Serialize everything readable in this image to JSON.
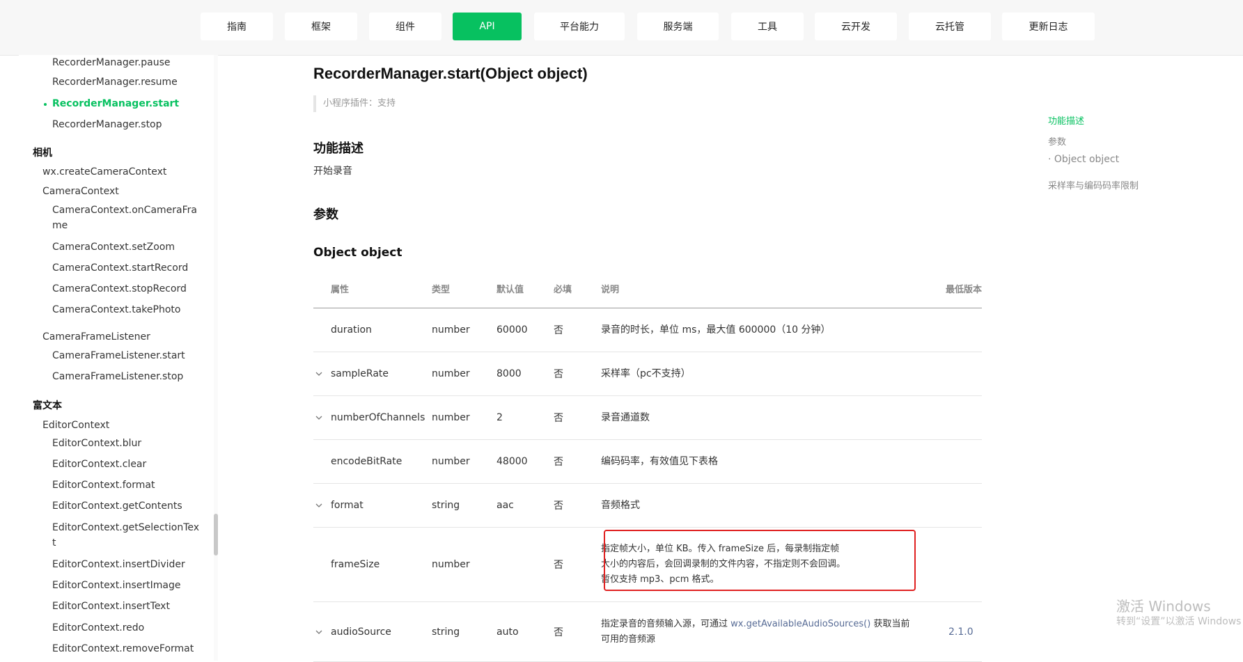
{
  "nav": {
    "items": [
      {
        "label": "指南"
      },
      {
        "label": "框架"
      },
      {
        "label": "组件"
      },
      {
        "label": "API"
      },
      {
        "label": "平台能力"
      },
      {
        "label": "服务端"
      },
      {
        "label": "工具"
      },
      {
        "label": "云开发"
      },
      {
        "label": "云托管"
      },
      {
        "label": "更新日志"
      }
    ],
    "active": "API"
  },
  "sidebar": {
    "items": [
      {
        "label": "RecorderManager.pause"
      },
      {
        "label": "RecorderManager.resume"
      },
      {
        "label": "RecorderManager.start"
      },
      {
        "label": "RecorderManager.stop"
      },
      {
        "label": "相机"
      },
      {
        "label": "wx.createCameraContext"
      },
      {
        "label": "CameraContext"
      },
      {
        "label": "CameraContext.onCameraFra"
      },
      {
        "label": "me"
      },
      {
        "label": "CameraContext.setZoom"
      },
      {
        "label": "CameraContext.startRecord"
      },
      {
        "label": "CameraContext.stopRecord"
      },
      {
        "label": "CameraContext.takePhoto"
      },
      {
        "label": "CameraFrameListener"
      },
      {
        "label": "CameraFrameListener.start"
      },
      {
        "label": "CameraFrameListener.stop"
      },
      {
        "label": "富文本"
      },
      {
        "label": "EditorContext"
      },
      {
        "label": "EditorContext.blur"
      },
      {
        "label": "EditorContext.clear"
      },
      {
        "label": "EditorContext.format"
      },
      {
        "label": "EditorContext.getContents"
      },
      {
        "label": "EditorContext.getSelectionTex"
      },
      {
        "label": "t"
      },
      {
        "label": "EditorContext.insertDivider"
      },
      {
        "label": "EditorContext.insertImage"
      },
      {
        "label": "EditorContext.insertText"
      },
      {
        "label": "EditorContext.redo"
      },
      {
        "label": "EditorContext.removeFormat"
      }
    ]
  },
  "main": {
    "title": "RecorderManager.start(Object object)",
    "tip": "小程序插件：支持",
    "section_desc": "功能描述",
    "desc": "开始录音",
    "section_params": "参数",
    "object_heading": "Object object",
    "table": {
      "headers": [
        "属性",
        "类型",
        "默认值",
        "必填",
        "说明",
        "最低版本"
      ],
      "rows": [
        {
          "name": "duration",
          "type": "number",
          "default": "60000",
          "required": "否",
          "desc": "录音的时长，单位 ms，最大值 600000（10 分钟）",
          "version": ""
        },
        {
          "name": "sampleRate",
          "type": "number",
          "default": "8000",
          "required": "否",
          "desc": "采样率（pc不支持）",
          "version": ""
        },
        {
          "name": "numberOfChannels",
          "type": "number",
          "default": "2",
          "required": "否",
          "desc": "录音通道数",
          "version": ""
        },
        {
          "name": "encodeBitRate",
          "type": "number",
          "default": "48000",
          "required": "否",
          "desc": "编码码率，有效值见下表格",
          "version": ""
        },
        {
          "name": "format",
          "type": "string",
          "default": "aac",
          "required": "否",
          "desc": "音频格式",
          "version": ""
        },
        {
          "name": "frameSize",
          "type": "number",
          "default": "",
          "required": "否",
          "desc": "指定帧大小，单位 KB。传入 frameSize 后，每录制指定帧大小的内容后，会回调录制的文件内容，不指定则不会回调。暂仅支持 mp3、pcm 格式。",
          "version": ""
        },
        {
          "name": "audioSource",
          "type": "string",
          "default": "auto",
          "required": "否",
          "desc_pre": "指定录音的音频输入源，可通过 ",
          "desc_link": "wx.getAvailableAudioSources()",
          "desc_post": " 获取当前可用的音频源",
          "version": "2.1.0"
        }
      ]
    }
  },
  "toc": {
    "items": [
      {
        "label": "功能描述"
      },
      {
        "label": "参数"
      },
      {
        "label": "· Object object"
      },
      {
        "label": "采样率与编码码率限制"
      }
    ]
  },
  "watermark": {
    "line1": "激活 Windows",
    "line2": "转到“设置”以激活 Windows"
  }
}
